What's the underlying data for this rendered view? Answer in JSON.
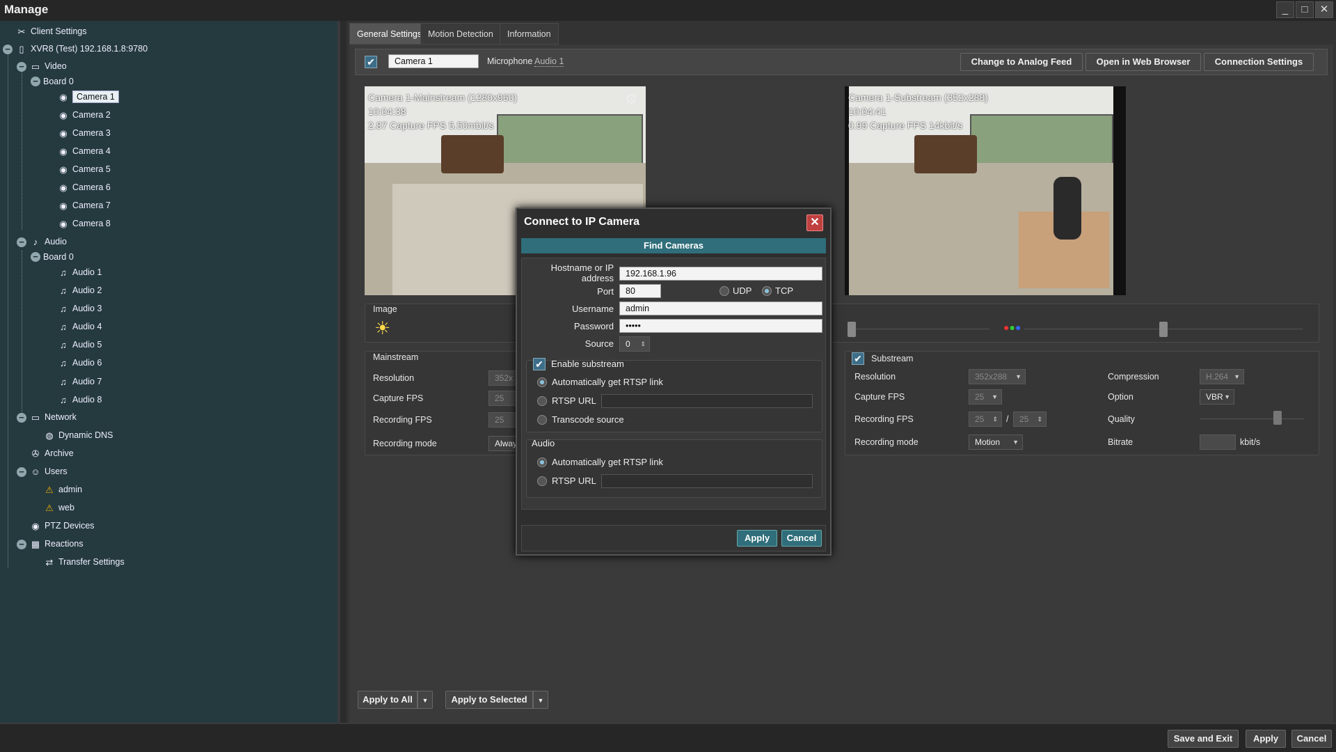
{
  "window": {
    "title": "Manage",
    "minimize": "_",
    "maximize": "□",
    "close": "✕"
  },
  "tree": {
    "client_settings": "Client Settings",
    "server": "XVR8 (Test) 192.168.1.8:9780",
    "video": "Video",
    "video_board": "Board 0",
    "cameras": [
      "Camera 1",
      "Camera 2",
      "Camera 3",
      "Camera 4",
      "Camera 5",
      "Camera 6",
      "Camera 7",
      "Camera 8"
    ],
    "audio": "Audio",
    "audio_board": "Board 0",
    "audios": [
      "Audio 1",
      "Audio 2",
      "Audio 3",
      "Audio 4",
      "Audio 5",
      "Audio 6",
      "Audio 7",
      "Audio 8"
    ],
    "network": "Network",
    "dynamic_dns": "Dynamic DNS",
    "archive": "Archive",
    "users": "Users",
    "user_admin": "admin",
    "user_web": "web",
    "ptz": "PTZ Devices",
    "reactions": "Reactions",
    "transfer": "Transfer Settings"
  },
  "tabs": [
    "General Settings",
    "Motion Detection",
    "Information"
  ],
  "toolbar": {
    "camera_name": "Camera 1",
    "microphone_label": "Microphone",
    "microphone_value": "Audio 1",
    "analog_btn": "Change to Analog Feed",
    "web_btn": "Open in Web Browser",
    "conn_btn": "Connection Settings"
  },
  "feeds": {
    "main": {
      "line1": "Camera 1-Mainstream (1280x960)",
      "line2": "10:04:38",
      "line3": "2.87 Capture FPS 5.50mbit/s"
    },
    "sub": {
      "line1": "Camera 1-Substream (352x288)",
      "line2": "10:04:41",
      "line3": "0.99 Capture FPS 14kbit/s"
    }
  },
  "image_group": {
    "title": "Image"
  },
  "mainstream": {
    "title": "Mainstream",
    "resolution_label": "Resolution",
    "resolution_value": "352x",
    "capture_label": "Capture FPS",
    "capture_value": "25",
    "recording_fps_label": "Recording FPS",
    "recording_fps_value": "25",
    "mode_label": "Recording mode",
    "mode_value": "Alway"
  },
  "substream": {
    "title": "Substream",
    "resolution_label": "Resolution",
    "resolution_value": "352x288",
    "capture_label": "Capture FPS",
    "capture_value": "25",
    "recording_fps_label": "Recording FPS",
    "recording_fps_a": "25",
    "recording_fps_sep": "/",
    "recording_fps_b": "25",
    "mode_label": "Recording mode",
    "mode_value": "Motion",
    "compression_label": "Compression",
    "compression_value": "H.264",
    "option_label": "Option",
    "option_value": "VBR",
    "quality_label": "Quality",
    "bitrate_label": "Bitrate",
    "bitrate_unit": "kbit/s"
  },
  "bottom_main": {
    "apply_all": "Apply to All",
    "apply_selected": "Apply to Selected"
  },
  "bottom_bar": {
    "save_exit": "Save and Exit",
    "apply": "Apply",
    "cancel": "Cancel"
  },
  "dialog": {
    "title": "Connect to IP Camera",
    "find": "Find Cameras",
    "host_label_1": "Hostname or IP",
    "host_label_2": "address",
    "host_value": "192.168.1.96",
    "port_label": "Port",
    "port_value": "80",
    "udp": "UDP",
    "tcp": "TCP",
    "user_label": "Username",
    "user_value": "admin",
    "pass_label": "Password",
    "pass_value": "•••••",
    "source_label": "Source",
    "source_value": "0",
    "enable_sub": "Enable substream",
    "auto_rtsp": "Automatically get RTSP link",
    "rtsp_url": "RTSP URL",
    "transcode": "Transcode source",
    "audio_title": "Audio",
    "audio_auto": "Automatically get RTSP link",
    "audio_rtsp": "RTSP URL",
    "apply": "Apply",
    "cancel": "Cancel"
  },
  "colors": {
    "tree_bg": "#253a3f",
    "accent": "#2f6e7a",
    "check": "#3d6e89"
  }
}
